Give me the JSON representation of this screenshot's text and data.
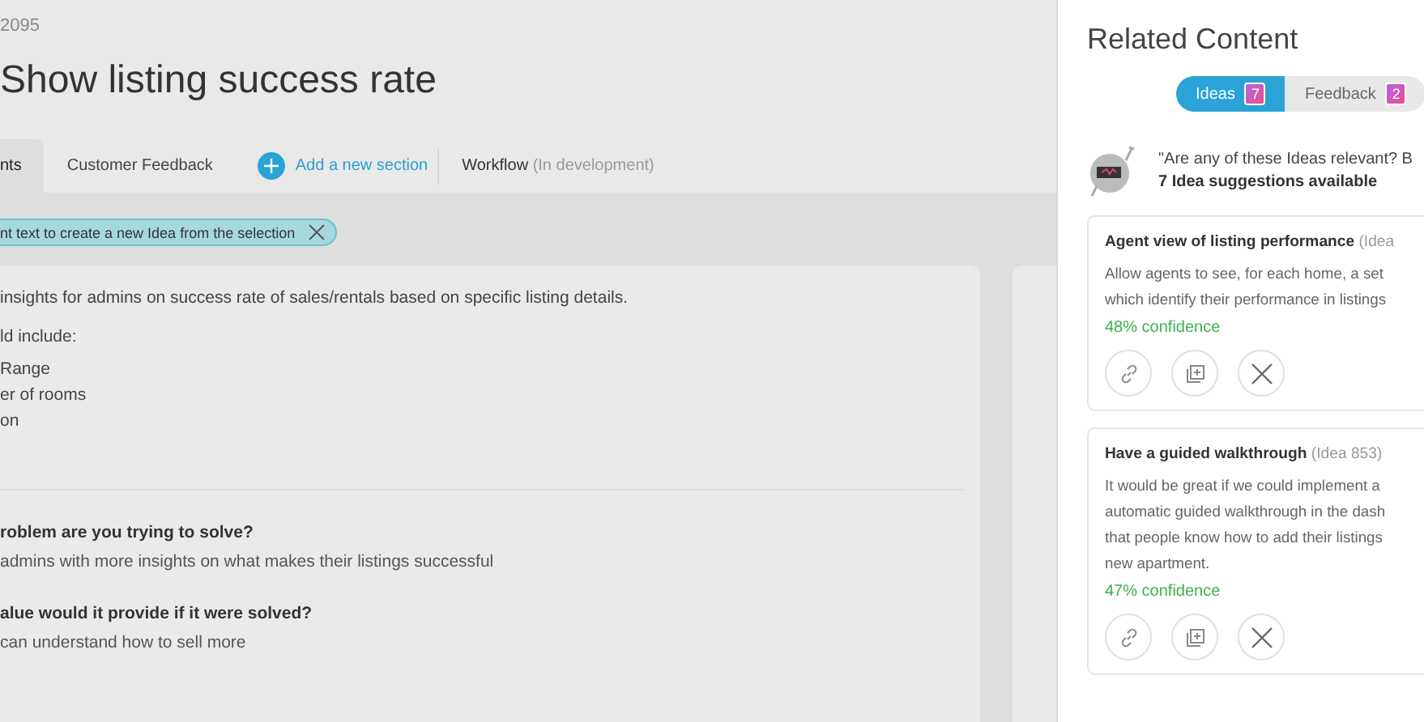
{
  "idea_ref": "2095",
  "title": "Show listing success rate",
  "tabs": [
    {
      "label": "nts",
      "selected": true
    },
    {
      "label": "Customer Feedback",
      "selected": false
    }
  ],
  "add_section": "Add a new section",
  "workflow": {
    "label": "Workflow",
    "note": "(In development)"
  },
  "selection_hint": "nt text to create a new Idea from the selection",
  "description": {
    "lines": [
      "insights for admins on success rate of sales/rentals based on specific listing details.",
      "ld include:"
    ],
    "list": [
      "Range",
      "er of rooms",
      "on"
    ]
  },
  "questions": [
    {
      "question": "roblem are you trying to solve?",
      "answer": "admins with more insights on what makes their listings successful"
    },
    {
      "question": "alue would it provide if it were solved?",
      "answer": "can understand how to sell more"
    }
  ],
  "related": {
    "title": "Related Content",
    "toggle": [
      {
        "label": "Ideas",
        "count": "7",
        "selected": true
      },
      {
        "label": "Feedback",
        "count": "2",
        "selected": false
      }
    ],
    "prompt": "\"Are any of these Ideas relevant? B",
    "summary": "7 Idea suggestions available",
    "suggestions": [
      {
        "title": "Agent view of listing performance",
        "ref": "(Idea",
        "lines": [
          "Allow agents to see, for each home, a set",
          "which identify their performance in listings"
        ],
        "confidence": "48% confidence"
      },
      {
        "title": "Have a guided walkthrough",
        "ref": "(Idea 853)",
        "lines": [
          "It would be great if we could implement a",
          "automatic guided walkthrough in the dash",
          "that people know how to add their listings",
          "new apartment."
        ],
        "confidence": "47% confidence"
      }
    ]
  }
}
